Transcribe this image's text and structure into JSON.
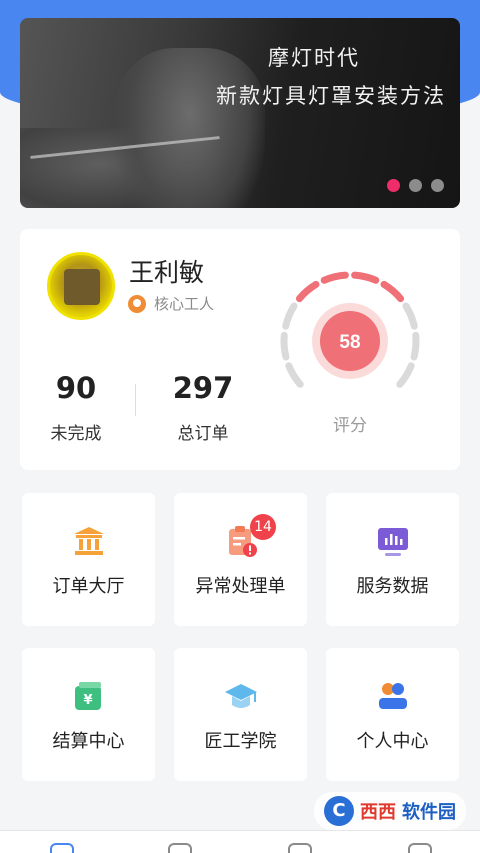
{
  "banner": {
    "title": "摩灯时代",
    "subtitle": "新款灯具灯罩安装方法",
    "dots": 3,
    "active_dot": 0
  },
  "profile": {
    "name": "王利敏",
    "badge": "核心工人",
    "stats": [
      {
        "value": "90",
        "label": "未完成"
      },
      {
        "value": "297",
        "label": "总订单"
      }
    ],
    "score": "58",
    "score_label": "评分"
  },
  "tiles": [
    {
      "label": "订单大厅",
      "icon": "bank-icon",
      "color": "#f5a23a"
    },
    {
      "label": "异常处理单",
      "icon": "clipboard-alert-icon",
      "color": "#f37a52",
      "badge": "14"
    },
    {
      "label": "服务数据",
      "icon": "chart-monitor-icon",
      "color": "#7b5bd6"
    },
    {
      "label": "结算中心",
      "icon": "wallet-yen-icon",
      "color": "#3fbf7f"
    },
    {
      "label": "匠工学院",
      "icon": "graduation-cap-icon",
      "color": "#5fb8ec"
    },
    {
      "label": "个人中心",
      "icon": "user-group-icon",
      "color": "#3b73e8"
    }
  ],
  "watermark": {
    "part1": "西西",
    "part2": "软件园",
    "logo": "C"
  },
  "colors": {
    "accent": "#4a86f0",
    "gauge": "#f07077",
    "badge_red": "#f0424a"
  }
}
